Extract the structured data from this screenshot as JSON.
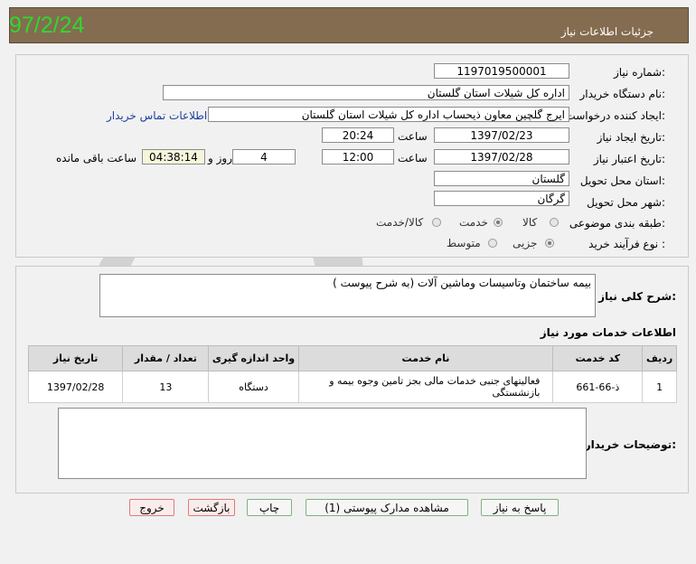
{
  "header": {
    "title": "جزئیات اطلاعات نیاز",
    "date_stamp": "97/2/24"
  },
  "form": {
    "need_number": {
      "label": "شماره نیاز:",
      "value": "1197019500001"
    },
    "buyer_org": {
      "label": "نام دستگاه خریدار:",
      "value": "اداره کل شیلات استان گلستان"
    },
    "requester": {
      "label": "ایجاد کننده درخواست:",
      "value": "ایرج گلچین معاون ذیحساب اداره کل شیلات استان گلستان",
      "contact_link": "اطلاعات تماس خریدار"
    },
    "creation_date": {
      "label": "تاریخ ایجاد نیاز:",
      "date": "1397/02/23",
      "time_label": "ساعت",
      "time": "20:24"
    },
    "validity": {
      "label": "تاریخ اعتبار نیاز:",
      "date": "1397/02/28",
      "time_label": "ساعت",
      "time": "12:00",
      "days": "4",
      "days_label": "روز و",
      "remaining": "04:38:14",
      "remaining_label": "ساعت باقی مانده"
    },
    "province": {
      "label": "استان محل تحویل:",
      "value": "گلستان"
    },
    "city": {
      "label": "شهر محل تحویل:",
      "value": "گرگان"
    },
    "category": {
      "label": "طبقه بندی موضوعی:",
      "options": [
        "کالا",
        "خدمت",
        "کالا/خدمت"
      ],
      "selected": "خدمت"
    },
    "process": {
      "label": "نوع فرآیند خرید :",
      "options": [
        "جزیی",
        "متوسط"
      ],
      "selected": "جزیی"
    }
  },
  "summary": {
    "label": "شرح کلی نیاز:",
    "value": "بیمه ساختمان وتاسیسات وماشین آلات (به شرح پیوست )"
  },
  "services": {
    "title": "اطلاعات خدمات مورد نیاز",
    "columns": [
      "ردیف",
      "کد خدمت",
      "نام خدمت",
      "واحد اندازه گیری",
      "تعداد / مقدار",
      "تاریخ نیاز"
    ],
    "rows": [
      {
        "index": "1",
        "code": "ذ-66-661",
        "name": "فعالیتهای جنبی خدمات مالی بجز تامین وجوه بیمه و بازنشستگی",
        "unit": "دستگاه",
        "qty": "13",
        "date": "1397/02/28"
      }
    ]
  },
  "buyer_notes": {
    "label": "توضیحات خریدار:",
    "value": ""
  },
  "buttons": {
    "reply": "پاسخ به نیاز",
    "attachments": "مشاهده مدارک پیوستی (1)",
    "print": "چاپ",
    "back": "بازگشت",
    "exit": "خروج"
  },
  "colors": {
    "header_bg": "#846c50",
    "date_stamp": "#2fd82f",
    "link": "#1f3f9f"
  }
}
